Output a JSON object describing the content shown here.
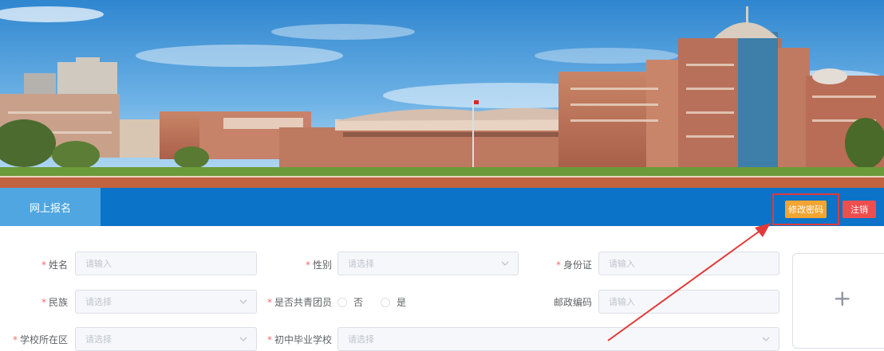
{
  "nav": {
    "tab_label": "网上报名"
  },
  "header_buttons": {
    "change_password": "修改密码",
    "logout": "注销"
  },
  "colors": {
    "nav_bg": "#0b73c8",
    "tab_bg": "#4fa6e0",
    "change_btn": "#f2a531",
    "logout_btn": "#ef4e4e",
    "highlight": "#e23a3a"
  },
  "form": {
    "name": {
      "label": "姓名",
      "placeholder": "请输入"
    },
    "gender": {
      "label": "性别",
      "placeholder": "请选择"
    },
    "id_card": {
      "label": "身份证",
      "placeholder": "请输入"
    },
    "ethnicity": {
      "label": "民族",
      "placeholder": "请选择"
    },
    "league_member": {
      "label": "是否共青团员",
      "options": [
        "否",
        "是"
      ]
    },
    "postal_code": {
      "label": "邮政编码",
      "placeholder": "请输入"
    },
    "school_district": {
      "label": "学校所在区",
      "placeholder": "请选择"
    },
    "middle_school": {
      "label": "初中毕业学校",
      "placeholder": "请选择"
    },
    "photo_upload_icon": "plus-icon"
  }
}
